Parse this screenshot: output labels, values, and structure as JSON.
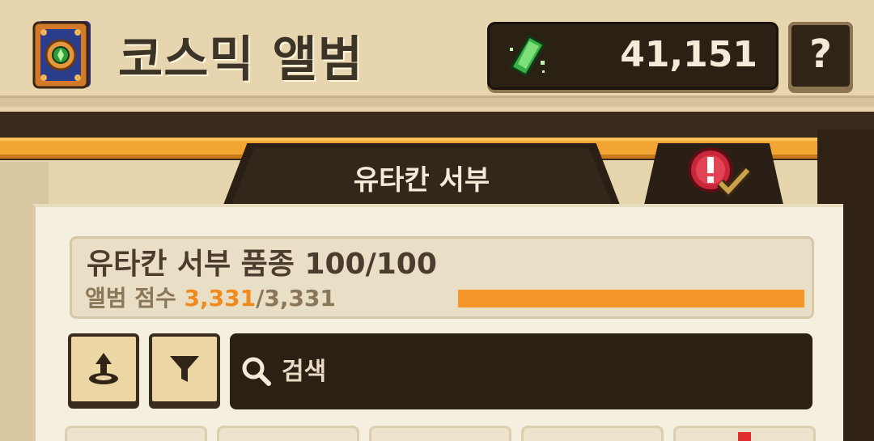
{
  "header": {
    "title": "코스믹 앨범",
    "gem_count": "41,151",
    "help_label": "?",
    "album_icon": "album-book-icon",
    "gem_icon": "green-gem-icon"
  },
  "tabs": [
    {
      "label": "유타칸 서부",
      "active": true
    },
    {
      "icon": "alert-check-icon",
      "active": false
    }
  ],
  "breed_card": {
    "title": "유타칸 서부 품종 100/100",
    "score_label": "앨범 점수",
    "score_current": "3,331",
    "score_total": "/3,331",
    "progress": 1.0
  },
  "controls": {
    "sort_icon": "sort-icon",
    "filter_icon": "filter-icon",
    "search_placeholder": "검색"
  },
  "colors": {
    "accent_orange": "#f5962a",
    "dark_panel": "#2a2014",
    "paper": "#f5efdf"
  }
}
